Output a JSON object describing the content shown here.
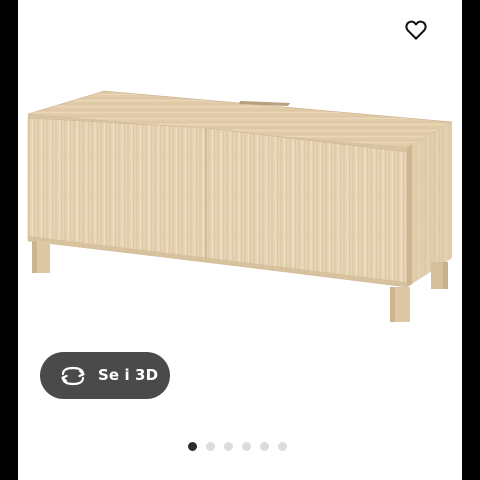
{
  "view3d": {
    "label": "Se i 3D"
  },
  "icons": {
    "favorite": "heart-outline-icon",
    "rotate": "rotate-3d-icon"
  },
  "carousel": {
    "total": 6,
    "active_index": 0
  },
  "colors": {
    "wood": "#e3cfae",
    "button": "#4a4a4a",
    "dot_active": "#2b2b2b",
    "dot_inactive": "#dcdcdc"
  }
}
